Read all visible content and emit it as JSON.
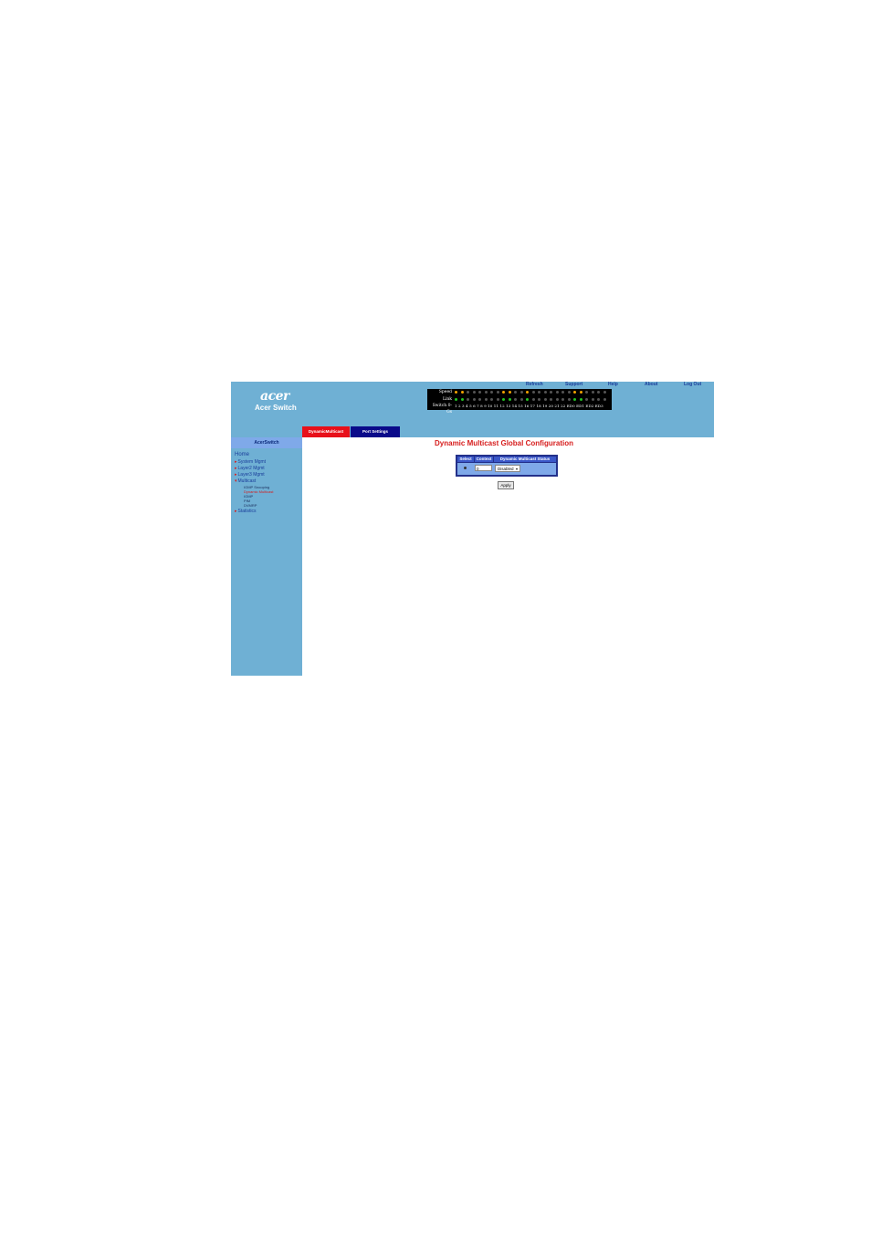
{
  "header": {
    "logo": "acer",
    "product": "Acer Switch",
    "links": [
      "Refresh",
      "Support",
      "Help",
      "About",
      "Log Out"
    ]
  },
  "port_panel": {
    "speed_label": "Speed",
    "link_label": "Link",
    "switch_label": "Switch 0-Gs",
    "port_numbers": "1 2 3 4 5 6 7 8 9 10 11 12 13 14 15 16 17 18 19 20 21 22 ED0 ED1 ED2 ED3",
    "colors": {
      "amber": "#f2a300",
      "green": "#22c422",
      "off": "#555555"
    }
  },
  "sidebar": {
    "title": "AcerSwitch",
    "home": "Home",
    "items": [
      "System Mgmt",
      "Layer2 Mgmt",
      "Layer3 Mgmt",
      "Multicast"
    ],
    "multicast_sub": [
      "IGMP Snooping",
      "Dynamic Multicast",
      "IGMP",
      "PIM",
      "DVMRP"
    ],
    "statistics": "Statistics"
  },
  "tabs": [
    "DynamicMulticast",
    "Port Settings"
  ],
  "main": {
    "title": "Dynamic Multicast Global Configuration",
    "table": {
      "headers": [
        "Select",
        "Context",
        "Dynamic Multicast Status"
      ],
      "row": {
        "context": "0",
        "status": "Disabled"
      }
    },
    "apply": "Apply"
  },
  "colors": {
    "frame": "#6fb0d4",
    "title_red": "#d61c1c",
    "active_tab": "#e8101a",
    "inactive_tab": "#0a0a8a"
  }
}
